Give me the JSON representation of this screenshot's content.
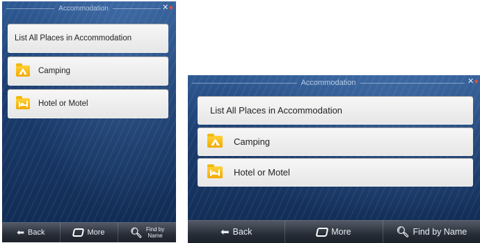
{
  "screens": [
    {
      "title": "Accommodation",
      "menu": [
        {
          "label": "List All Places in Accommodation",
          "icon": ""
        },
        {
          "label": "Camping",
          "icon": "camping-tent-icon"
        },
        {
          "label": "Hotel or Motel",
          "icon": "hotel-bed-icon"
        }
      ],
      "toolbar": {
        "back": "Back",
        "more": "More",
        "find_line1": "Find by",
        "find_line2": "Name"
      }
    },
    {
      "title": "Accommodation",
      "menu": [
        {
          "label": "List All Places in Accommodation",
          "icon": ""
        },
        {
          "label": "Camping",
          "icon": "camping-tent-icon"
        },
        {
          "label": "Hotel or Motel",
          "icon": "hotel-bed-icon"
        }
      ],
      "toolbar": {
        "back": "Back",
        "more": "More",
        "find": "Find by Name"
      }
    }
  ],
  "colors": {
    "screen_bg": "#1c3e70",
    "item_bg": "#eeeeee",
    "folder": "#f7be16",
    "toolbar_bg": "#2a303a",
    "gps_dot": "#e14b3b"
  }
}
